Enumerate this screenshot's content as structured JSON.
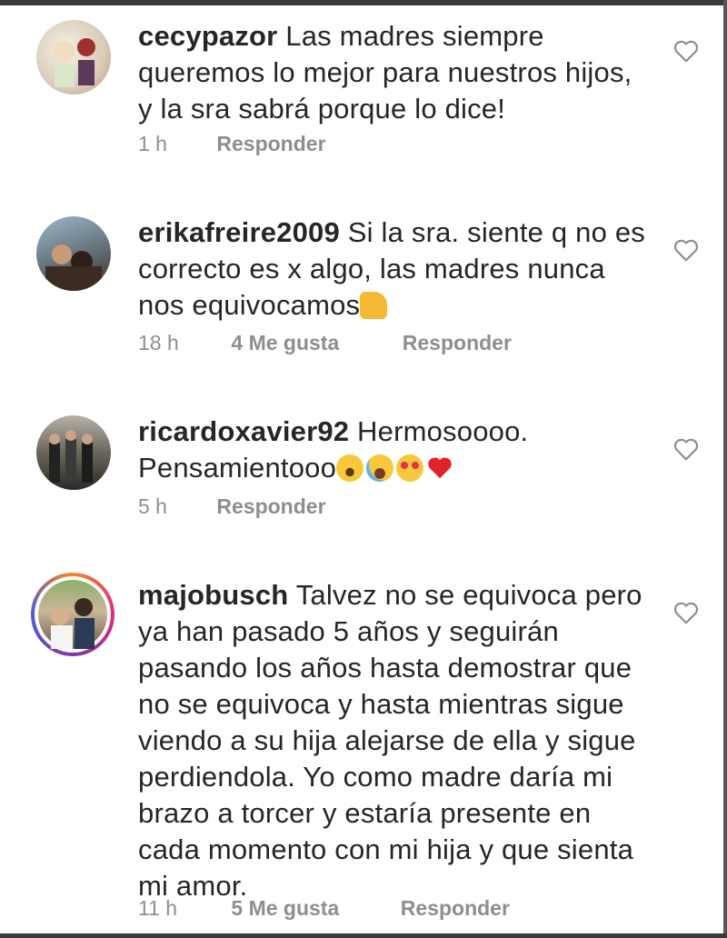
{
  "comments": [
    {
      "username": "cecypazor",
      "text": "Las madres siempre queremos lo mejor para nuestros hijos, y la sra sabrá porque lo dice!",
      "time": "1 h",
      "likes": "",
      "reply": "Responder"
    },
    {
      "username": "erikafreire2009",
      "text": "Si la sra. siente q no es correcto es x algo, las madres nunca nos equivocamos",
      "emoji": [
        "thumbs-up"
      ],
      "time": "18 h",
      "likes": "4 Me gusta",
      "reply": "Responder"
    },
    {
      "username": "ricardoxavier92",
      "text": "Hermosoooo. Pensamientooo",
      "emoji": [
        "astonished-face",
        "tears-of-joy-face",
        "heart-eyes-face",
        "red-heart"
      ],
      "time": "5 h",
      "likes": "",
      "reply": "Responder"
    },
    {
      "username": "majobusch",
      "text": "Talvez no se equivoca pero ya han pasado 5 años y seguirán pasando los años hasta demostrar que no se equivoca y hasta mientras sigue viendo a su hija alejarse de ella y sigue perdiendola. Yo como madre daría mi brazo a torcer y estaría presente en cada momento con mi hija y que sienta mi amor.",
      "time": "11 h",
      "likes": "5 Me gusta",
      "reply": "Responder"
    }
  ],
  "colors": {
    "text": "#262626",
    "meta": "#8e8e8e",
    "background": "#ffffff"
  },
  "icons": {
    "like": "heart-outline-icon"
  }
}
